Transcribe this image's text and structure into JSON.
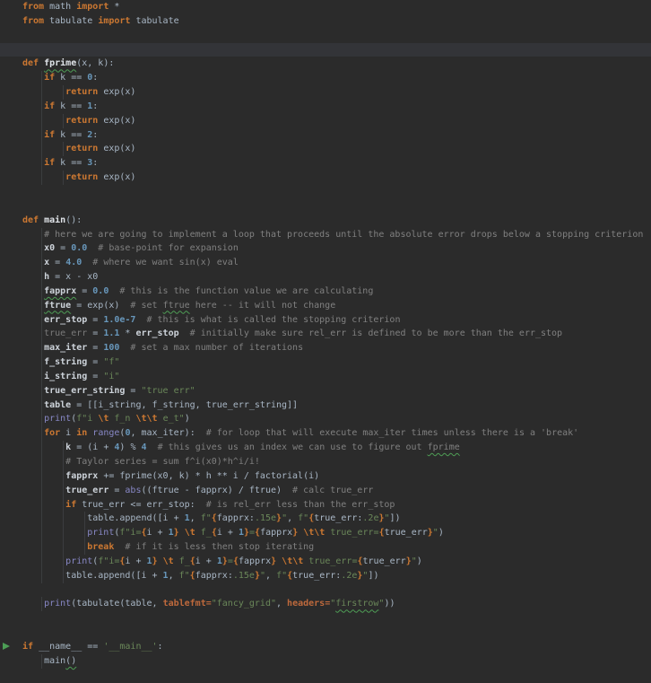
{
  "editor": {
    "language_visible_code": "python",
    "syntax_colors": {
      "background": "#2b2b2b",
      "caret_row": "#333438",
      "keyword": "#cc7832",
      "plain": "#a9b7c6",
      "variable": "#cdd3da",
      "number": "#6897bb",
      "string": "#6a8759",
      "comment": "#808080",
      "builtin": "#8888c6",
      "keyword_argument": "#be693c",
      "typo_underline": "#4e9d55",
      "run_arrow": "#4c9e55",
      "indent_guide": "#3b3d3f"
    },
    "icons": [
      {
        "name": "run-gutter-icon",
        "glyph": "green-play-triangle",
        "line": 46
      }
    ],
    "lines": [
      {
        "i": 0,
        "t": [
          [
            "k",
            "from"
          ],
          [
            "p",
            " math "
          ],
          [
            "k",
            "import"
          ],
          [
            "p",
            " *"
          ]
        ]
      },
      {
        "i": 0,
        "t": [
          [
            "k",
            "from"
          ],
          [
            "p",
            " tabulate "
          ],
          [
            "k",
            "import"
          ],
          [
            "p",
            " tabulate"
          ]
        ]
      },
      {
        "i": 0,
        "t": []
      },
      {
        "i": 0,
        "t": [],
        "hl": true
      },
      {
        "i": 0,
        "t": [
          [
            "k",
            "def"
          ],
          [
            "p",
            " "
          ],
          [
            "f t",
            "fprime"
          ],
          [
            "p",
            "(x, k):"
          ]
        ]
      },
      {
        "i": 1,
        "t": [
          [
            "p",
            "    "
          ],
          [
            "k",
            "if"
          ],
          [
            "p",
            " k == "
          ],
          [
            "n",
            "0"
          ],
          [
            "p",
            ":"
          ]
        ]
      },
      {
        "i": 2,
        "t": [
          [
            "p",
            "        "
          ],
          [
            "k",
            "return"
          ],
          [
            "p",
            " exp(x)"
          ]
        ]
      },
      {
        "i": 1,
        "t": [
          [
            "p",
            "    "
          ],
          [
            "k",
            "if"
          ],
          [
            "p",
            " k == "
          ],
          [
            "n",
            "1"
          ],
          [
            "p",
            ":"
          ]
        ]
      },
      {
        "i": 2,
        "t": [
          [
            "p",
            "        "
          ],
          [
            "k",
            "return"
          ],
          [
            "p",
            " exp(x)"
          ]
        ]
      },
      {
        "i": 1,
        "t": [
          [
            "p",
            "    "
          ],
          [
            "k",
            "if"
          ],
          [
            "p",
            " k == "
          ],
          [
            "n",
            "2"
          ],
          [
            "p",
            ":"
          ]
        ]
      },
      {
        "i": 2,
        "t": [
          [
            "p",
            "        "
          ],
          [
            "k",
            "return"
          ],
          [
            "p",
            " exp(x)"
          ]
        ]
      },
      {
        "i": 1,
        "t": [
          [
            "p",
            "    "
          ],
          [
            "k",
            "if"
          ],
          [
            "p",
            " k == "
          ],
          [
            "n",
            "3"
          ],
          [
            "p",
            ":"
          ]
        ]
      },
      {
        "i": 2,
        "t": [
          [
            "p",
            "        "
          ],
          [
            "k",
            "return"
          ],
          [
            "p",
            " exp(x)"
          ]
        ]
      },
      {
        "i": 0,
        "t": []
      },
      {
        "i": 0,
        "t": []
      },
      {
        "i": 0,
        "t": [
          [
            "k",
            "def"
          ],
          [
            "p",
            " "
          ],
          [
            "f",
            "main"
          ],
          [
            "p",
            "():"
          ]
        ]
      },
      {
        "i": 1,
        "t": [
          [
            "p",
            "    "
          ],
          [
            "c",
            "# here we are going to implement a loop that proceeds until the absolute error drops below a stopping criterion"
          ]
        ]
      },
      {
        "i": 1,
        "t": [
          [
            "p",
            "    "
          ],
          [
            "v",
            "x0"
          ],
          [
            "p",
            " = "
          ],
          [
            "n",
            "0.0"
          ],
          [
            "c",
            "  # base-point for expansion"
          ]
        ]
      },
      {
        "i": 1,
        "t": [
          [
            "p",
            "    "
          ],
          [
            "v",
            "x"
          ],
          [
            "p",
            " = "
          ],
          [
            "n",
            "4.0"
          ],
          [
            "c",
            "  # where we want sin(x) eval"
          ]
        ]
      },
      {
        "i": 1,
        "t": [
          [
            "p",
            "    "
          ],
          [
            "v",
            "h"
          ],
          [
            "p",
            " = x - x0"
          ]
        ]
      },
      {
        "i": 1,
        "t": [
          [
            "p",
            "    "
          ],
          [
            "v t",
            "fapprx"
          ],
          [
            "p",
            " = "
          ],
          [
            "n",
            "0.0"
          ],
          [
            "c",
            "  # this is the function value we are calculating"
          ]
        ]
      },
      {
        "i": 1,
        "t": [
          [
            "p",
            "    "
          ],
          [
            "v t",
            "ftrue"
          ],
          [
            "p",
            " = exp(x)"
          ],
          [
            "c",
            "  # set "
          ],
          [
            "c t",
            "ftrue"
          ],
          [
            "c",
            " here -- it will not change"
          ]
        ]
      },
      {
        "i": 1,
        "t": [
          [
            "p",
            "    "
          ],
          [
            "v",
            "err_stop"
          ],
          [
            "p",
            " = "
          ],
          [
            "n",
            "1.0e-7"
          ],
          [
            "c",
            "  # this is what is called the stopping criterion"
          ]
        ]
      },
      {
        "i": 1,
        "t": [
          [
            "p",
            "    "
          ],
          [
            "d",
            "true_err"
          ],
          [
            "p",
            " = "
          ],
          [
            "n",
            "1.1"
          ],
          [
            "p",
            " * "
          ],
          [
            "v",
            "err_stop"
          ],
          [
            "c",
            "  # initially make sure rel_err is defined to be more than the err_stop"
          ]
        ]
      },
      {
        "i": 1,
        "t": [
          [
            "p",
            "    "
          ],
          [
            "v",
            "max_iter"
          ],
          [
            "p",
            " = "
          ],
          [
            "n",
            "100"
          ],
          [
            "c",
            "  # set a max number of iterations"
          ]
        ]
      },
      {
        "i": 1,
        "t": [
          [
            "p",
            "    "
          ],
          [
            "v",
            "f_string"
          ],
          [
            "p",
            " = "
          ],
          [
            "s",
            "\"f\""
          ]
        ]
      },
      {
        "i": 1,
        "t": [
          [
            "p",
            "    "
          ],
          [
            "v",
            "i_string"
          ],
          [
            "p",
            " = "
          ],
          [
            "s",
            "\"i\""
          ]
        ]
      },
      {
        "i": 1,
        "t": [
          [
            "p",
            "    "
          ],
          [
            "v",
            "true_err_string"
          ],
          [
            "p",
            " = "
          ],
          [
            "s",
            "\"true err\""
          ]
        ]
      },
      {
        "i": 1,
        "t": [
          [
            "p",
            "    "
          ],
          [
            "v",
            "table"
          ],
          [
            "p",
            " = [[i_string, f_string, true_err_string]]"
          ]
        ]
      },
      {
        "i": 1,
        "t": [
          [
            "p",
            "    "
          ],
          [
            "b",
            "print"
          ],
          [
            "p",
            "("
          ],
          [
            "s",
            "f\"i "
          ],
          [
            "e",
            "\\t"
          ],
          [
            "s",
            " f_n "
          ],
          [
            "e",
            "\\t\\t"
          ],
          [
            "s",
            " e_t\""
          ],
          [
            "p",
            ")"
          ]
        ]
      },
      {
        "i": 1,
        "t": [
          [
            "p",
            "    "
          ],
          [
            "k",
            "for"
          ],
          [
            "p",
            " i "
          ],
          [
            "k",
            "in"
          ],
          [
            "p",
            " "
          ],
          [
            "b",
            "range"
          ],
          [
            "p",
            "("
          ],
          [
            "n",
            "0"
          ],
          [
            "p",
            ", max_iter):"
          ],
          [
            "c",
            "  # for loop that will execute max_iter times unless there is a 'break'"
          ]
        ]
      },
      {
        "i": 2,
        "t": [
          [
            "p",
            "        "
          ],
          [
            "v",
            "k"
          ],
          [
            "p",
            " = (i + "
          ],
          [
            "n",
            "4"
          ],
          [
            "p",
            ") % "
          ],
          [
            "n",
            "4"
          ],
          [
            "c",
            "  # this gives us an index we can use to figure out "
          ],
          [
            "c t",
            "fprime"
          ]
        ]
      },
      {
        "i": 2,
        "t": [
          [
            "p",
            "        "
          ],
          [
            "c",
            "# Taylor series = sum f^i(x0)*h^i/i!"
          ]
        ]
      },
      {
        "i": 2,
        "t": [
          [
            "p",
            "        "
          ],
          [
            "v",
            "fapprx"
          ],
          [
            "p",
            " += fprime(x0, k) * h ** i / factorial(i)"
          ]
        ]
      },
      {
        "i": 2,
        "t": [
          [
            "p",
            "        "
          ],
          [
            "v",
            "true_err"
          ],
          [
            "p",
            " = "
          ],
          [
            "b",
            "abs"
          ],
          [
            "p",
            "((ftrue - fapprx) / ftrue)"
          ],
          [
            "c",
            "  # calc true_err"
          ]
        ]
      },
      {
        "i": 2,
        "t": [
          [
            "p",
            "        "
          ],
          [
            "k",
            "if"
          ],
          [
            "p",
            " true_err <= err_stop:"
          ],
          [
            "c",
            "  # is rel_err less than the err_stop"
          ]
        ]
      },
      {
        "i": 3,
        "t": [
          [
            "p",
            "            "
          ],
          [
            "p",
            "table.append([i + "
          ],
          [
            "n",
            "1"
          ],
          [
            "p",
            ", "
          ],
          [
            "s",
            "f\""
          ],
          [
            "e",
            "{"
          ],
          [
            "p",
            "fapprx:"
          ],
          [
            "s",
            ".15e"
          ],
          [
            "e",
            "}"
          ],
          [
            "s",
            "\""
          ],
          [
            "p",
            ", "
          ],
          [
            "s",
            "f\""
          ],
          [
            "e",
            "{"
          ],
          [
            "p",
            "true_err:"
          ],
          [
            "s",
            ".2e"
          ],
          [
            "e",
            "}"
          ],
          [
            "s",
            "\""
          ],
          [
            "p",
            "])"
          ]
        ]
      },
      {
        "i": 3,
        "t": [
          [
            "p",
            "            "
          ],
          [
            "b",
            "print"
          ],
          [
            "p",
            "("
          ],
          [
            "s",
            "f\"i="
          ],
          [
            "e",
            "{"
          ],
          [
            "p",
            "i + "
          ],
          [
            "n",
            "1"
          ],
          [
            "e",
            "}"
          ],
          [
            "s",
            " "
          ],
          [
            "e",
            "\\t"
          ],
          [
            "s",
            " f_"
          ],
          [
            "e",
            "{"
          ],
          [
            "p",
            "i + "
          ],
          [
            "n",
            "1"
          ],
          [
            "e",
            "}"
          ],
          [
            "s",
            "="
          ],
          [
            "e",
            "{"
          ],
          [
            "p",
            "fapprx"
          ],
          [
            "e",
            "}"
          ],
          [
            "s",
            " "
          ],
          [
            "e",
            "\\t\\t"
          ],
          [
            "s",
            " true_err="
          ],
          [
            "e",
            "{"
          ],
          [
            "p",
            "true_err"
          ],
          [
            "e",
            "}"
          ],
          [
            "s",
            "\""
          ],
          [
            "p",
            ")"
          ]
        ]
      },
      {
        "i": 3,
        "t": [
          [
            "p",
            "            "
          ],
          [
            "k",
            "break"
          ],
          [
            "c",
            "  # if it is less then stop iterating"
          ]
        ]
      },
      {
        "i": 2,
        "t": [
          [
            "p",
            "        "
          ],
          [
            "b",
            "print"
          ],
          [
            "p",
            "("
          ],
          [
            "s",
            "f\"i="
          ],
          [
            "e",
            "{"
          ],
          [
            "p",
            "i + "
          ],
          [
            "n",
            "1"
          ],
          [
            "e",
            "}"
          ],
          [
            "s",
            " "
          ],
          [
            "e",
            "\\t"
          ],
          [
            "s",
            " f_"
          ],
          [
            "e",
            "{"
          ],
          [
            "p",
            "i + "
          ],
          [
            "n",
            "1"
          ],
          [
            "e",
            "}"
          ],
          [
            "s",
            "="
          ],
          [
            "e",
            "{"
          ],
          [
            "p",
            "fapprx"
          ],
          [
            "e",
            "}"
          ],
          [
            "s",
            " "
          ],
          [
            "e",
            "\\t\\t"
          ],
          [
            "s",
            " true_err="
          ],
          [
            "e",
            "{"
          ],
          [
            "p",
            "true_err"
          ],
          [
            "e",
            "}"
          ],
          [
            "s",
            "\""
          ],
          [
            "p",
            ")"
          ]
        ]
      },
      {
        "i": 2,
        "t": [
          [
            "p",
            "        "
          ],
          [
            "p",
            "table.append([i + "
          ],
          [
            "n",
            "1"
          ],
          [
            "p",
            ", "
          ],
          [
            "s",
            "f\""
          ],
          [
            "e",
            "{"
          ],
          [
            "p",
            "fapprx:"
          ],
          [
            "s",
            ".15e"
          ],
          [
            "e",
            "}"
          ],
          [
            "s",
            "\""
          ],
          [
            "p",
            ", "
          ],
          [
            "s",
            "f\""
          ],
          [
            "e",
            "{"
          ],
          [
            "p",
            "true_err:"
          ],
          [
            "s",
            ".2e"
          ],
          [
            "e",
            "}"
          ],
          [
            "s",
            "\""
          ],
          [
            "p",
            "])"
          ]
        ]
      },
      {
        "i": 0,
        "t": []
      },
      {
        "i": 1,
        "t": [
          [
            "p",
            "    "
          ],
          [
            "b",
            "print"
          ],
          [
            "p",
            "(tabulate(table, "
          ],
          [
            "a",
            "tablefmt="
          ],
          [
            "s",
            "\"fancy_grid\""
          ],
          [
            "p",
            ", "
          ],
          [
            "a",
            "headers="
          ],
          [
            "s",
            "\""
          ],
          [
            "s t",
            "firstrow"
          ],
          [
            "s",
            "\""
          ],
          [
            "p",
            "))"
          ]
        ]
      },
      {
        "i": 0,
        "t": []
      },
      {
        "i": 0,
        "t": []
      },
      {
        "i": 0,
        "t": [
          [
            "k",
            "if"
          ],
          [
            "p",
            " __name__ == "
          ],
          [
            "s",
            "'__main__'"
          ],
          [
            "p",
            ":"
          ]
        ],
        "run": true
      },
      {
        "i": 1,
        "t": [
          [
            "p",
            "    main"
          ],
          [
            "p t",
            "()"
          ]
        ]
      },
      {
        "i": 0,
        "t": []
      }
    ]
  }
}
